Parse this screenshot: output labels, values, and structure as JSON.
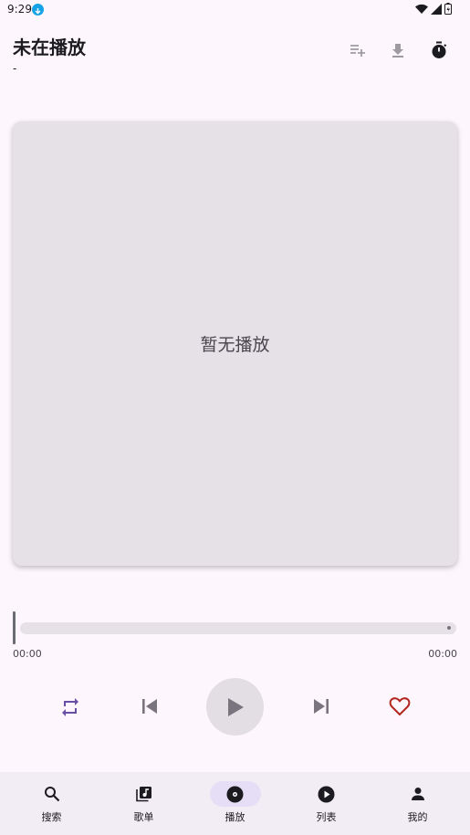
{
  "status_bar": {
    "time": "9:29"
  },
  "header": {
    "title": "未在播放",
    "subtitle": "-"
  },
  "icons": {
    "add_to_playlist": "playlist-add-icon",
    "download": "download-icon",
    "timer": "timer-icon",
    "repeat": "repeat-icon",
    "previous": "skip-previous-icon",
    "play": "play-icon",
    "next": "skip-next-icon",
    "favorite": "heart-outline-icon"
  },
  "artwork": {
    "placeholder": "暂无播放"
  },
  "progress": {
    "current": "00:00",
    "total": "00:00",
    "fraction": 0
  },
  "colors": {
    "accent": "#6750a4",
    "favorite": "#b3261e",
    "background": "#fdf7fd"
  },
  "bottom_nav": {
    "items": [
      {
        "label": "搜索",
        "icon": "search-icon"
      },
      {
        "label": "歌单",
        "icon": "library-music-icon"
      },
      {
        "label": "播放",
        "icon": "disc-icon",
        "active": true
      },
      {
        "label": "列表",
        "icon": "play-circle-icon"
      },
      {
        "label": "我的",
        "icon": "person-icon"
      }
    ]
  }
}
